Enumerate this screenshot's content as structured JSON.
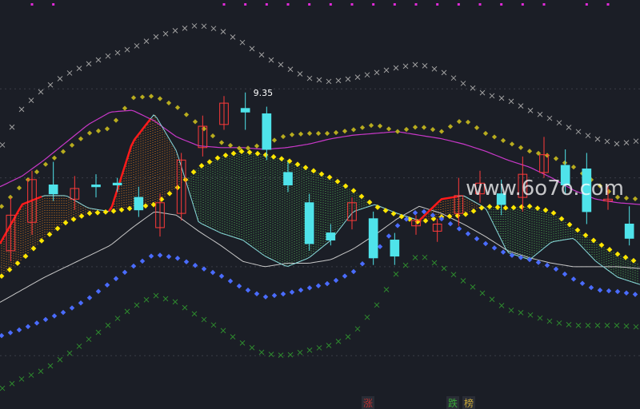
{
  "chart_data": {
    "type": "candlestick",
    "peak_label": "9.35",
    "watermark": "www.6o7o.com",
    "marker_labels": [
      "涨",
      "跌",
      "榜"
    ],
    "colors": {
      "background": "#1b1e26",
      "grid": "#3a3d46",
      "up_candle": "#ff3a3a",
      "down_candle": "#4fe3ea",
      "rising_segment": "#ff1a1a",
      "band_fill_up": "#ff8c1a",
      "band_fill_down": "#5fd35f",
      "fast_line": "#88d8dc",
      "magenta_line": "#c838c8",
      "white_line": "#c8c8c8",
      "yellow_dots": "#ffe600",
      "olive_dots": "#b8ac1e",
      "gray_crosses": "#a0a0a0",
      "blue_dots": "#4a6cff",
      "green_crosses": "#2e8a2e",
      "top_markers": "#e02ad8",
      "watermark": "#ffffff"
    },
    "series": {
      "yellow_dots": [
        -0.6,
        0.4,
        1.6,
        2.5,
        3.0,
        3.1,
        3.3,
        3.5,
        4.4,
        5.6,
        6.2,
        6.5,
        6.3,
        6.0,
        5.5,
        5.0,
        4.3,
        3.4,
        2.9,
        2.5,
        2.8,
        2.9,
        3.4,
        3.3,
        3.4,
        3.1,
        2.2,
        1.4,
        0.7,
        0.2
      ],
      "olive_dots": [
        3.3,
        4.6,
        5.7,
        6.6,
        7.5,
        7.8,
        9.5,
        9.6,
        9.0,
        8.0,
        7.0,
        6.6,
        6.9,
        7.4,
        7.5,
        7.5,
        7.7,
        8.0,
        7.6,
        7.9,
        7.6,
        8.3,
        7.5,
        7.0,
        6.5,
        6.2,
        5.6,
        4.7,
        3.9,
        3.8
      ],
      "gray_crosses": [
        6.6,
        8.9,
        10.0,
        10.8,
        11.4,
        11.9,
        12.3,
        12.9,
        13.3,
        13.6,
        13.3,
        12.6,
        11.8,
        11.2,
        10.6,
        10.4,
        10.6,
        10.9,
        11.2,
        11.4,
        11.0,
        10.3,
        9.7,
        9.4,
        8.8,
        8.3,
        7.7,
        7.2,
        6.9,
        7.1
      ],
      "magenta_line": [
        4.5,
        5.1,
        6.0,
        7.0,
        8.0,
        8.7,
        8.8,
        8.2,
        7.3,
        6.8,
        6.7,
        6.7,
        6.6,
        6.7,
        6.9,
        7.2,
        7.4,
        7.5,
        7.6,
        7.4,
        7.2,
        6.9,
        6.5,
        6.0,
        5.6,
        5.0,
        4.3,
        3.8,
        3.6,
        3.5
      ],
      "white_line": [
        -2.0,
        -1.3,
        -0.6,
        0.0,
        0.6,
        1.2,
        2.2,
        3.1,
        2.9,
        2.0,
        1.2,
        0.3,
        0.0,
        0.2,
        0.2,
        0.4,
        1.0,
        1.8,
        2.7,
        3.4,
        3.0,
        2.4,
        1.7,
        0.9,
        0.5,
        0.2,
        0.0,
        0.0,
        0.0,
        -0.1
      ],
      "blue_dots": [
        -3.9,
        -3.5,
        -3.0,
        -2.5,
        -1.8,
        -0.9,
        0.0,
        0.7,
        0.5,
        0.0,
        -0.5,
        -1.2,
        -1.7,
        -1.5,
        -1.2,
        -0.9,
        -0.3,
        0.8,
        2.3,
        3.2,
        2.7,
        2.0,
        1.3,
        0.7,
        0.4,
        0.0,
        -0.7,
        -1.3,
        -1.4,
        -1.6
      ],
      "green_crosses": [
        -6.9,
        -6.3,
        -5.8,
        -5.0,
        -4.1,
        -3.2,
        -2.3,
        -1.6,
        -2.0,
        -2.8,
        -3.5,
        -4.3,
        -4.9,
        -5.0,
        -4.7,
        -4.4,
        -3.8,
        -2.3,
        -0.3,
        0.7,
        0.0,
        -0.8,
        -1.6,
        -2.4,
        -2.7,
        -3.1,
        -3.3,
        -3.3,
        -3.3,
        -3.4
      ],
      "fast_line": [
        1.3,
        3.5,
        4.0,
        4.0,
        3.3,
        3.1,
        7.0,
        8.6,
        6.5,
        2.5,
        1.9,
        1.5,
        0.6,
        0.0,
        0.5,
        1.5,
        3.1,
        3.5,
        3.0,
        2.6,
        3.8,
        4.0,
        3.3,
        0.8,
        0.4,
        1.4,
        1.6,
        0.3,
        -0.6,
        -1.0
      ]
    },
    "candles": [
      {
        "o": 0.9,
        "c": 2.9,
        "h": 3.9,
        "l": 0.3
      },
      {
        "o": 2.5,
        "c": 4.9,
        "h": 5.4,
        "l": 1.8
      },
      {
        "o": 4.6,
        "c": 4.1,
        "h": 5.9,
        "l": 3.7
      },
      {
        "o": 3.8,
        "c": 4.4,
        "h": 5.1,
        "l": 3.2
      },
      {
        "o": 4.6,
        "c": 4.5,
        "h": 5.2,
        "l": 3.9
      },
      {
        "o": 4.7,
        "c": 4.6,
        "h": 5.0,
        "l": 4.2
      },
      {
        "o": 3.9,
        "c": 3.2,
        "h": 4.5,
        "l": 2.8
      },
      {
        "o": 2.2,
        "c": 3.6,
        "h": 4.1,
        "l": 1.7
      },
      {
        "o": 3.0,
        "c": 6.0,
        "h": 6.4,
        "l": 2.6
      },
      {
        "o": 6.7,
        "c": 7.9,
        "h": 8.5,
        "l": 6.2
      },
      {
        "o": 8.0,
        "c": 9.2,
        "h": 9.6,
        "l": 7.7
      },
      {
        "o": 8.9,
        "c": 8.7,
        "h": 9.8,
        "l": 7.7
      },
      {
        "o": 8.6,
        "c": 6.6,
        "h": 9.0,
        "l": 6.0
      },
      {
        "o": 5.3,
        "c": 4.6,
        "h": 5.9,
        "l": 4.2
      },
      {
        "o": 3.6,
        "c": 1.3,
        "h": 4.1,
        "l": 0.9
      },
      {
        "o": 1.9,
        "c": 1.5,
        "h": 2.4,
        "l": 1.2
      },
      {
        "o": 2.6,
        "c": 3.6,
        "h": 3.9,
        "l": 2.1
      },
      {
        "o": 2.7,
        "c": 0.5,
        "h": 3.1,
        "l": 0.1
      },
      {
        "o": 1.5,
        "c": 0.6,
        "h": 1.9,
        "l": 0.1
      },
      {
        "o": 2.3,
        "c": 2.6,
        "h": 2.9,
        "l": 1.8
      },
      {
        "o": 2.0,
        "c": 2.4,
        "h": 2.7,
        "l": 1.4
      },
      {
        "o": 3.0,
        "c": 4.0,
        "h": 5.0,
        "l": 2.3
      },
      {
        "o": 4.1,
        "c": 4.7,
        "h": 5.4,
        "l": 3.6
      },
      {
        "o": 4.1,
        "c": 3.5,
        "h": 4.9,
        "l": 2.9
      },
      {
        "o": 3.9,
        "c": 5.2,
        "h": 6.2,
        "l": 3.1
      },
      {
        "o": 5.3,
        "c": 6.3,
        "h": 7.3,
        "l": 5.0
      },
      {
        "o": 5.7,
        "c": 4.6,
        "h": 6.6,
        "l": 4.1
      },
      {
        "o": 5.5,
        "c": 3.1,
        "h": 6.4,
        "l": 2.4
      },
      {
        "o": 3.7,
        "c": 3.8,
        "h": 4.6,
        "l": 3.2
      },
      {
        "o": 2.4,
        "c": 1.6,
        "h": 3.4,
        "l": 1.2
      }
    ],
    "top_markers": [
      1,
      2,
      10,
      11,
      12,
      13,
      14,
      15,
      16,
      17,
      18,
      19,
      20,
      21,
      22,
      23,
      24,
      25,
      27,
      28
    ],
    "ylim": [
      -8,
      15
    ]
  }
}
